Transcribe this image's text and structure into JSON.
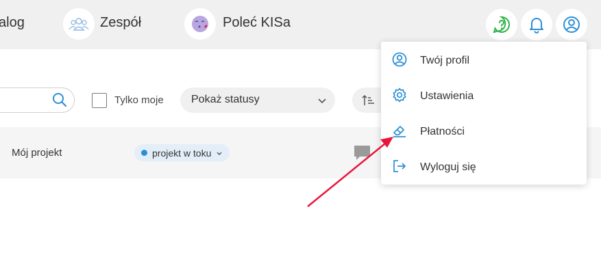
{
  "topnav": {
    "partial_label": "alog",
    "team_label": "Zespół",
    "refer_label": "Poleć KISa"
  },
  "filters": {
    "search_value": "",
    "only_mine_label": "Tylko moje",
    "status_select_label": "Pokaż statusy"
  },
  "project_row": {
    "name": "Mój projekt",
    "status": "projekt w toku",
    "status_color": "#2b8fd6"
  },
  "user_menu": {
    "items": [
      {
        "label": "Twój profil",
        "icon": "user-circle-icon"
      },
      {
        "label": "Ustawienia",
        "icon": "gear-icon"
      },
      {
        "label": "Płatności",
        "icon": "eraser-icon"
      },
      {
        "label": "Wyloguj się",
        "icon": "logout-icon"
      }
    ]
  },
  "colors": {
    "accent_blue": "#2b8fd6",
    "help_green": "#2fb34a",
    "annotation_arrow": "#e8163c",
    "topbar_bg": "#f0f0f0"
  }
}
